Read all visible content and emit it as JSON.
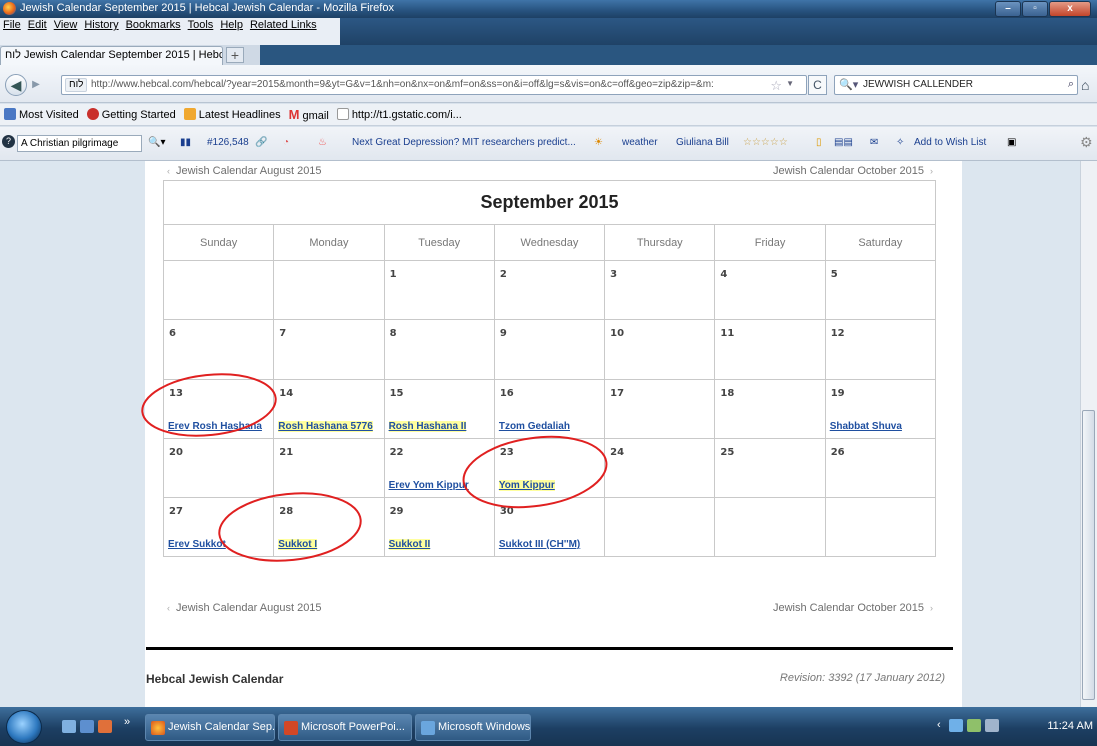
{
  "window": {
    "title": "Jewish Calendar September 2015 | Hebcal Jewish Calendar - Mozilla Firefox",
    "buttons": {
      "minimize": "–",
      "maximize": "▫",
      "close": "x"
    }
  },
  "menu": [
    "File",
    "Edit",
    "View",
    "History",
    "Bookmarks",
    "Tools",
    "Help",
    "Related Links"
  ],
  "tab": {
    "label": "Jewish Calendar September 2015 | Hebca...",
    "site_prefix": "לוח",
    "new_tab": "+"
  },
  "nav": {
    "site_badge": "לוח",
    "url": "http://www.hebcal.com/hebcal/?year=2015&month=9&yt=G&v=1&nh=on&nx=on&mf=on&ss=on&i=off&lg=s&vis=on&c=off&geo=zip&zip=&m:",
    "search_query": "JEWWISH CALLENDER"
  },
  "bookmarks": [
    "Most Visited",
    "Getting Started",
    "Latest Headlines",
    "gmail",
    "http://t1.gstatic.com/i..."
  ],
  "addon_toolbar": {
    "search_text": "A Christian pilgrimage",
    "count": "#126,548",
    "news": "Next Great Depression? MIT researchers predict...",
    "weather": "weather",
    "user": "Giuliana Bill",
    "wishlist": "Add to Wish List"
  },
  "calendar": {
    "prev_link": "Jewish Calendar August 2015",
    "next_link": "Jewish Calendar October 2015",
    "month_title": "September 2015",
    "weekdays": [
      "Sunday",
      "Monday",
      "Tuesday",
      "Wednesday",
      "Thursday",
      "Friday",
      "Saturday"
    ],
    "weeks": [
      [
        {
          "d": "",
          "e": ""
        },
        {
          "d": "",
          "e": ""
        },
        {
          "d": "1",
          "e": ""
        },
        {
          "d": "2",
          "e": ""
        },
        {
          "d": "3",
          "e": ""
        },
        {
          "d": "4",
          "e": ""
        },
        {
          "d": "5",
          "e": ""
        }
      ],
      [
        {
          "d": "6",
          "e": ""
        },
        {
          "d": "7",
          "e": ""
        },
        {
          "d": "8",
          "e": ""
        },
        {
          "d": "9",
          "e": ""
        },
        {
          "d": "10",
          "e": ""
        },
        {
          "d": "11",
          "e": ""
        },
        {
          "d": "12",
          "e": ""
        }
      ],
      [
        {
          "d": "13",
          "e": "Erev Rosh Hashana",
          "h": false
        },
        {
          "d": "14",
          "e": "Rosh Hashana 5776",
          "h": true
        },
        {
          "d": "15",
          "e": "Rosh Hashana II",
          "h": true
        },
        {
          "d": "16",
          "e": "Tzom Gedaliah",
          "h": false
        },
        {
          "d": "17",
          "e": ""
        },
        {
          "d": "18",
          "e": ""
        },
        {
          "d": "19",
          "e": "Shabbat Shuva",
          "h": false
        }
      ],
      [
        {
          "d": "20",
          "e": ""
        },
        {
          "d": "21",
          "e": ""
        },
        {
          "d": "22",
          "e": "Erev Yom Kippur",
          "h": false
        },
        {
          "d": "23",
          "e": "Yom Kippur",
          "h": true
        },
        {
          "d": "24",
          "e": ""
        },
        {
          "d": "25",
          "e": ""
        },
        {
          "d": "26",
          "e": ""
        }
      ],
      [
        {
          "d": "27",
          "e": "Erev Sukkot",
          "h": false
        },
        {
          "d": "28",
          "e": "Sukkot I",
          "h": true
        },
        {
          "d": "29",
          "e": "Sukkot II",
          "h": true
        },
        {
          "d": "30",
          "e": "Sukkot III (CH''M)",
          "h": false
        },
        {
          "d": "",
          "e": ""
        },
        {
          "d": "",
          "e": ""
        },
        {
          "d": "",
          "e": ""
        }
      ]
    ]
  },
  "footer": {
    "left": "Hebcal Jewish Calendar",
    "right": "Revision: 3392 (17 January 2012)"
  },
  "taskbar": {
    "items": [
      "Jewish Calendar Sep...",
      "Microsoft PowerPoi...",
      "Microsoft Windows"
    ],
    "clock": "11:24 AM"
  },
  "colors": {
    "event_link": "#1f4fa0",
    "highlight": "#ffff9e",
    "annotation": "#e02020"
  }
}
